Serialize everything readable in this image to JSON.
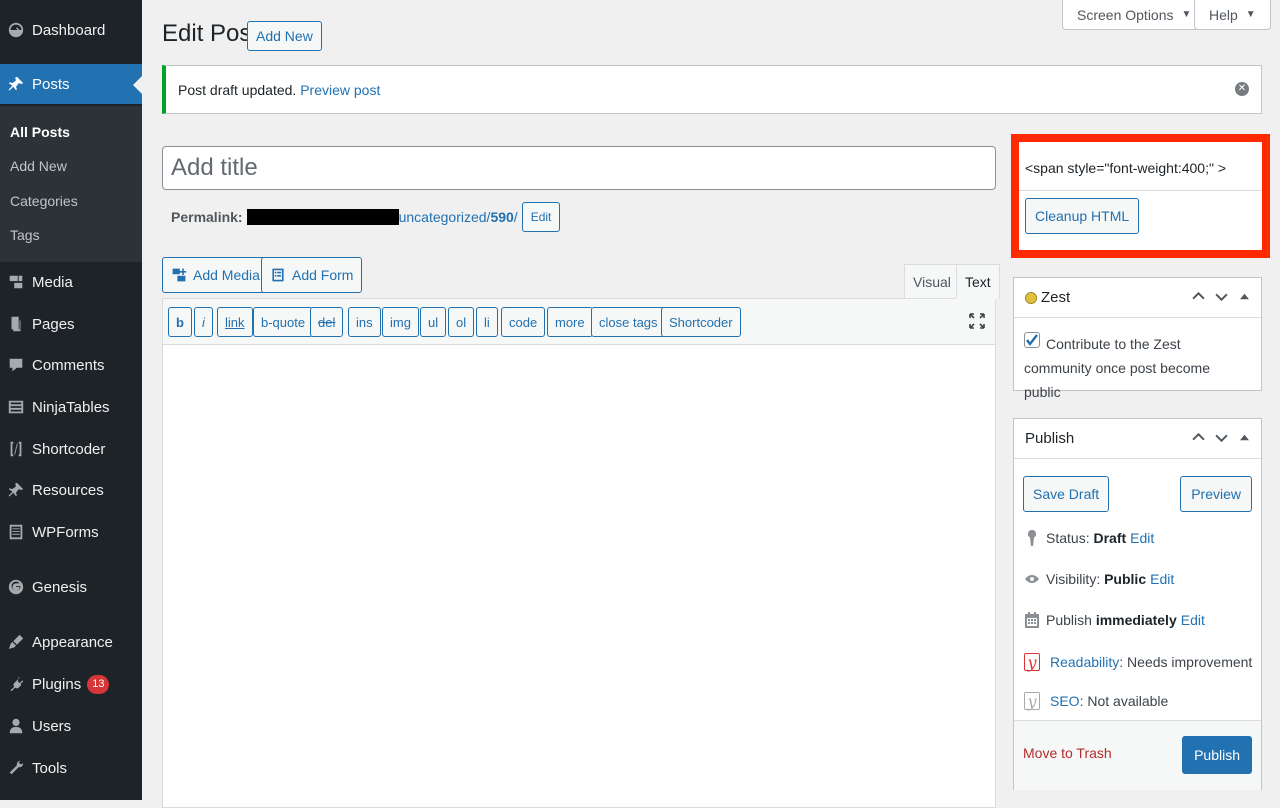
{
  "sidebar": {
    "items": [
      {
        "label": "Dashboard",
        "icon": "dashboard-icon"
      },
      {
        "label": "Posts",
        "icon": "pin-icon"
      },
      {
        "label": "Media",
        "icon": "media-icon"
      },
      {
        "label": "Pages",
        "icon": "pages-icon"
      },
      {
        "label": "Comments",
        "icon": "comments-icon"
      },
      {
        "label": "NinjaTables",
        "icon": "table-icon"
      },
      {
        "label": "Shortcoder",
        "icon": "shortcode-icon"
      },
      {
        "label": "Resources",
        "icon": "pin-icon"
      },
      {
        "label": "WPForms",
        "icon": "forms-icon"
      },
      {
        "label": "Genesis",
        "icon": "genesis-icon"
      },
      {
        "label": "Appearance",
        "icon": "brush-icon"
      },
      {
        "label": "Plugins",
        "icon": "plug-icon",
        "badge": "13"
      },
      {
        "label": "Users",
        "icon": "user-icon"
      },
      {
        "label": "Tools",
        "icon": "wrench-icon"
      }
    ],
    "submenu": [
      "All Posts",
      "Add New",
      "Categories",
      "Tags"
    ]
  },
  "top": {
    "screen_options": "Screen Options",
    "help": "Help",
    "page_title": "Edit Post",
    "add_new": "Add New"
  },
  "notice": {
    "text": "Post draft updated.",
    "link": "Preview post"
  },
  "title_field": {
    "placeholder": "Add title",
    "value": ""
  },
  "permalink": {
    "label": "Permalink:",
    "slug_prefix": "uncategorized/",
    "slug_id": "590",
    "slug_suffix": "/",
    "edit": "Edit"
  },
  "media_buttons": {
    "add_media": "Add Media",
    "add_form": "Add Form"
  },
  "tabs": {
    "visual": "Visual",
    "text": "Text"
  },
  "quicktags": [
    "b",
    "i",
    "link",
    "b-quote",
    "del",
    "ins",
    "img",
    "ul",
    "ol",
    "li",
    "code",
    "more",
    "close tags",
    "Shortcoder"
  ],
  "cleanup": {
    "code": "<span style=\"font-weight:400;\" >",
    "button": "Cleanup HTML",
    "highlight_color": "#ff2a00"
  },
  "zest": {
    "title": "Zest",
    "checkbox_label": "Contribute to the Zest community once post become public",
    "checked": true
  },
  "publish": {
    "title": "Publish",
    "save_draft": "Save Draft",
    "preview": "Preview",
    "status_label": "Status:",
    "status_value": "Draft",
    "visibility_label": "Visibility:",
    "visibility_value": "Public",
    "publish_label": "Publish",
    "publish_value": "immediately",
    "edit": "Edit",
    "readability_label": "Readability",
    "readability_value": ": Needs improvement",
    "seo_label": "SEO",
    "seo_value": ": Not available",
    "move_to_trash": "Move to Trash",
    "publish_button": "Publish"
  },
  "colors": {
    "admin_bar": "#1d2327",
    "accent": "#2271b1",
    "notice_success": "#00a32a",
    "trash": "#b32d2e",
    "badge": "#d63638"
  }
}
